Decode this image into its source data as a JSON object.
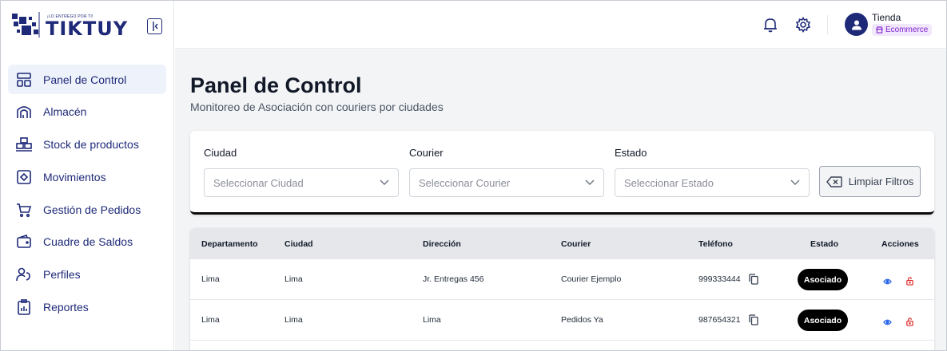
{
  "brand": {
    "tagline": "¡LO ENTREGO POR TI!",
    "name": "TIKTUY",
    "primary_color": "#1e2a78"
  },
  "sidebar": {
    "items": [
      {
        "label": "Panel de Control",
        "icon": "dashboard-icon",
        "active": true
      },
      {
        "label": "Almacén",
        "icon": "warehouse-icon",
        "active": false
      },
      {
        "label": "Stock de productos",
        "icon": "boxes-icon",
        "active": false
      },
      {
        "label": "Movimientos",
        "icon": "movements-icon",
        "active": false
      },
      {
        "label": "Gestión de Pedidos",
        "icon": "cart-icon",
        "active": false
      },
      {
        "label": "Cuadre de Saldos",
        "icon": "wallet-icon",
        "active": false
      },
      {
        "label": "Perfiles",
        "icon": "profiles-icon",
        "active": false
      },
      {
        "label": "Reportes",
        "icon": "reports-icon",
        "active": false
      }
    ]
  },
  "header": {
    "user_name": "Tienda",
    "user_role": "Ecommerce",
    "role_color": "#7e22ce"
  },
  "page": {
    "title": "Panel de Control",
    "subtitle": "Monitoreo de Asociación con couriers por ciudades"
  },
  "filters": {
    "ciudad_label": "Ciudad",
    "ciudad_placeholder": "Seleccionar Ciudad",
    "courier_label": "Courier",
    "courier_placeholder": "Seleccionar Courier",
    "estado_label": "Estado",
    "estado_placeholder": "Seleccionar Estado",
    "clear_label": "Limpiar Filtros"
  },
  "table": {
    "headers": [
      "Departamento",
      "Ciudad",
      "Dirección",
      "Courier",
      "Teléfono",
      "Estado",
      "Acciones"
    ],
    "rows": [
      {
        "departamento": "Lima",
        "ciudad": "Lima",
        "direccion": "Jr. Entregas 456",
        "courier": "Courier Ejemplo",
        "telefono": "999333444",
        "estado": "Asociado"
      },
      {
        "departamento": "Lima",
        "ciudad": "Lima",
        "direccion": "Lima",
        "courier": "Pedidos Ya",
        "telefono": "987654321",
        "estado": "Asociado"
      }
    ]
  }
}
